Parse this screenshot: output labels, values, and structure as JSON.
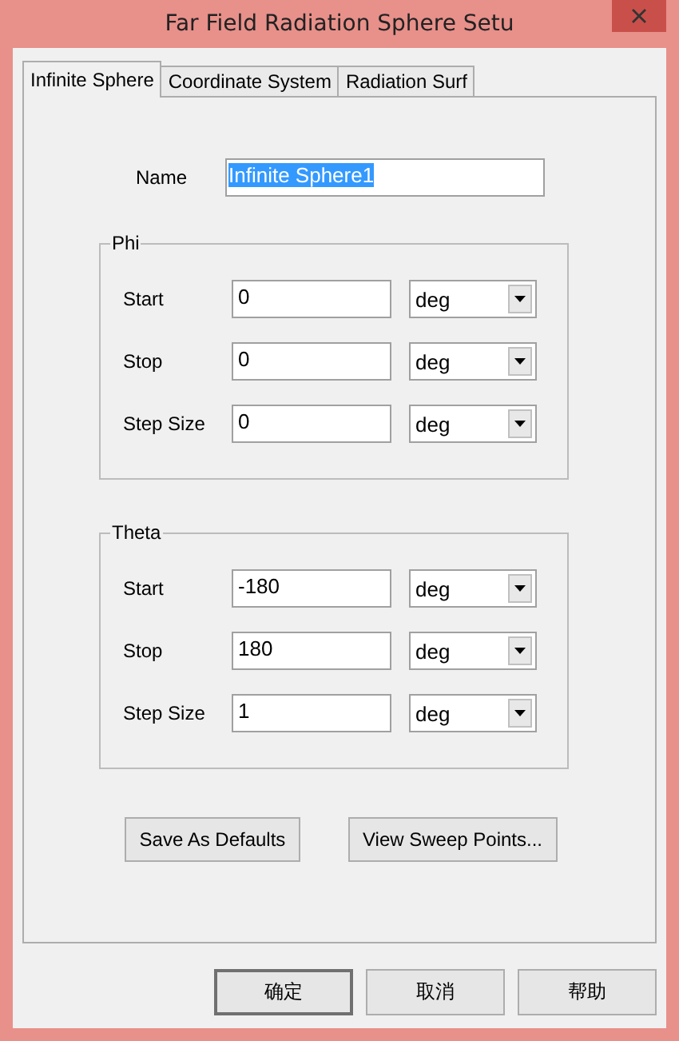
{
  "window": {
    "title": "Far Field Radiation Sphere Setu"
  },
  "tabs": [
    {
      "label": "Infinite Sphere",
      "selected": true
    },
    {
      "label": "Coordinate System",
      "selected": false
    },
    {
      "label": "Radiation Surf",
      "selected": false
    }
  ],
  "name_field": {
    "label": "Name",
    "value": "Infinite Sphere1",
    "text_selected": true
  },
  "groups": [
    {
      "title": "Phi",
      "rows": [
        {
          "label": "Start",
          "value": "0",
          "unit": "deg"
        },
        {
          "label": "Stop",
          "value": "0",
          "unit": "deg"
        },
        {
          "label": "Step Size",
          "value": "0",
          "unit": "deg"
        }
      ]
    },
    {
      "title": "Theta",
      "rows": [
        {
          "label": "Start",
          "value": "-180",
          "unit": "deg"
        },
        {
          "label": "Stop",
          "value": "180",
          "unit": "deg"
        },
        {
          "label": "Step Size",
          "value": "1",
          "unit": "deg"
        }
      ]
    }
  ],
  "panel_buttons": [
    "Save As Defaults",
    "View Sweep Points..."
  ],
  "dialog_buttons": [
    {
      "label": "确定",
      "default": true
    },
    {
      "label": "取消",
      "default": false
    },
    {
      "label": "帮助",
      "default": false
    }
  ]
}
